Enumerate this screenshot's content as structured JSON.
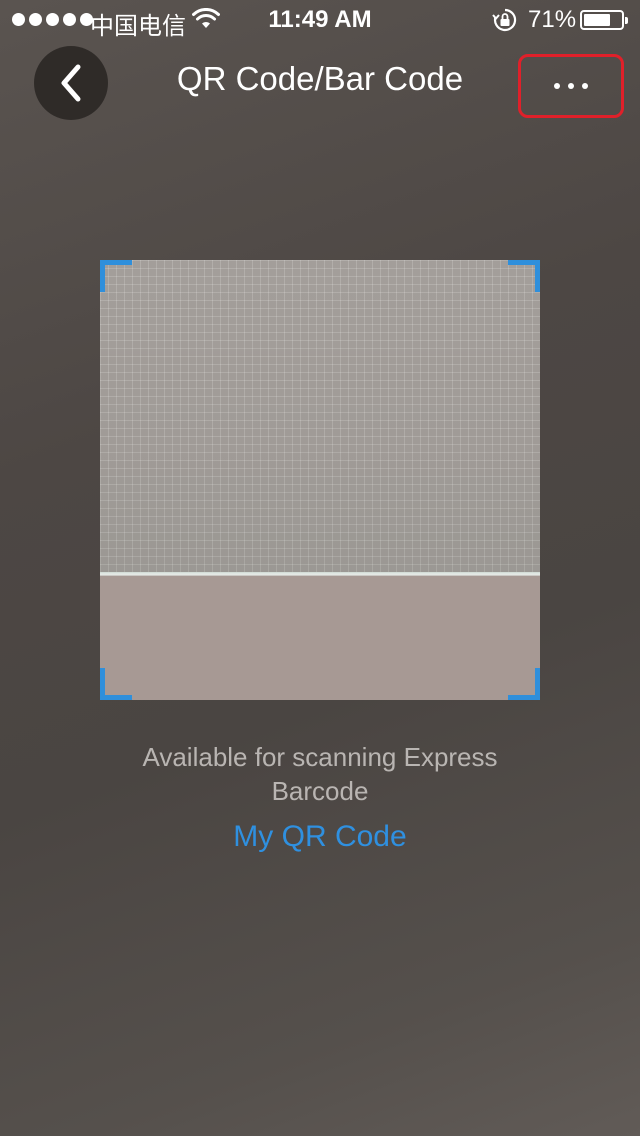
{
  "status_bar": {
    "carrier": "中国电信",
    "time": "11:49 AM",
    "battery_percent": "71%",
    "battery_level": 0.71,
    "signal_bars": 5,
    "icons": [
      "signal-dots-icon",
      "wifi-icon",
      "rotation-lock-icon",
      "battery-icon"
    ]
  },
  "nav": {
    "title": "QR Code/Bar Code",
    "back_icon": "chevron-left-icon",
    "more_icon": "more-dots-icon"
  },
  "scanner": {
    "hint": "Available for scanning Express Barcode",
    "my_qr_link": "My QR Code",
    "corner_color": "#2f8fdb"
  },
  "colors": {
    "accent": "#2f90e0",
    "highlight_border": "#e0202a"
  }
}
